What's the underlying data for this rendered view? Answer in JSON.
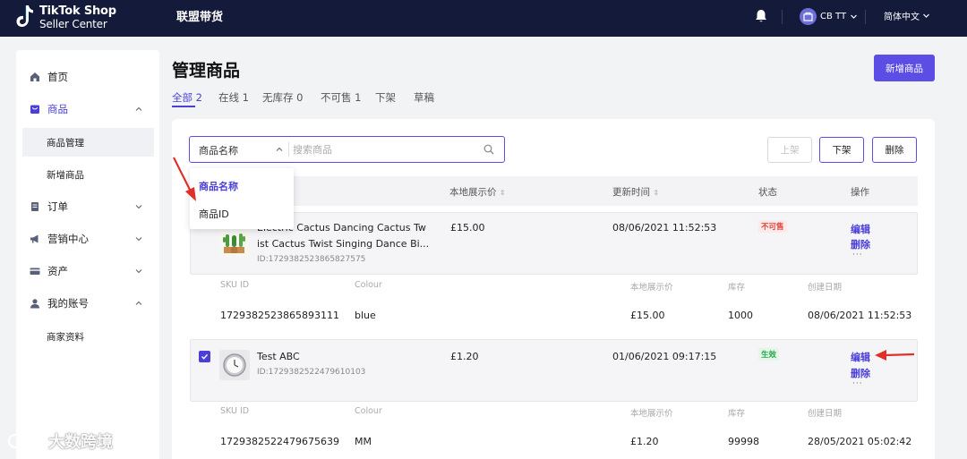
{
  "topbar": {
    "logo_line1": "TikTok Shop",
    "logo_line2": "Seller Center",
    "section_title": "联盟带货",
    "account_name": "CB TT",
    "language": "简体中文"
  },
  "sidebar": {
    "home": "首页",
    "products": "商品",
    "product_manage": "商品管理",
    "add_product": "新增商品",
    "orders": "订单",
    "marketing": "营销中心",
    "assets": "资产",
    "my_account": "我的账号",
    "merchant_profile": "商家资料"
  },
  "main": {
    "title": "管理商品",
    "new_button": "新增商品",
    "tabs": [
      "全部 2",
      "在线 1",
      "无库存 0",
      "不可售 1",
      "下架",
      "草稿"
    ]
  },
  "search": {
    "selected_field": "商品名称",
    "placeholder": "搜索商品",
    "options": [
      "商品名称",
      "商品ID"
    ]
  },
  "actions": {
    "publish": "上架",
    "unpublish": "下架",
    "delete": "删除"
  },
  "table": {
    "headers": {
      "price": "本地展示价",
      "updated": "更新时间",
      "status": "状态",
      "operations": "操作"
    },
    "sku_headers": {
      "sku_id": "SKU ID",
      "colour": "Colour",
      "price": "本地展示价",
      "stock": "库存",
      "created": "创建日期"
    },
    "products": [
      {
        "name_line1": "Electric Cactus Dancing Cactus Tw",
        "name_line2": "ist Cactus Twist Singing Dance Bi...",
        "id": "ID:1729382523865827575",
        "price": "£15.00",
        "updated": "08/06/2021 11:52:53",
        "status": "不可售",
        "edit": "编辑",
        "delete": "删除",
        "more": "···",
        "sku": {
          "sku_id": "1729382523865893111",
          "colour": "blue",
          "price": "£15.00",
          "stock": "1000",
          "created": "08/06/2021 11:52:53"
        }
      },
      {
        "name_line1": "Test ABC",
        "name_line2": "",
        "id": "ID:1729382522479610103",
        "price": "£1.20",
        "updated": "01/06/2021 09:17:15",
        "status": "生效",
        "edit": "编辑",
        "delete": "删除",
        "more": "···",
        "sku": {
          "sku_id": "1729382522479675639",
          "colour": "MM",
          "price": "£1.20",
          "stock": "99998",
          "created": "28/05/2021 05:02:42"
        }
      }
    ]
  },
  "watermark": "大数跨境",
  "colors": {
    "topbar": "#141a3a",
    "accent": "#5c4ee5",
    "annotation_red": "#e0302a",
    "status_unavailable": "#e0463c",
    "status_active": "#23a84a"
  }
}
